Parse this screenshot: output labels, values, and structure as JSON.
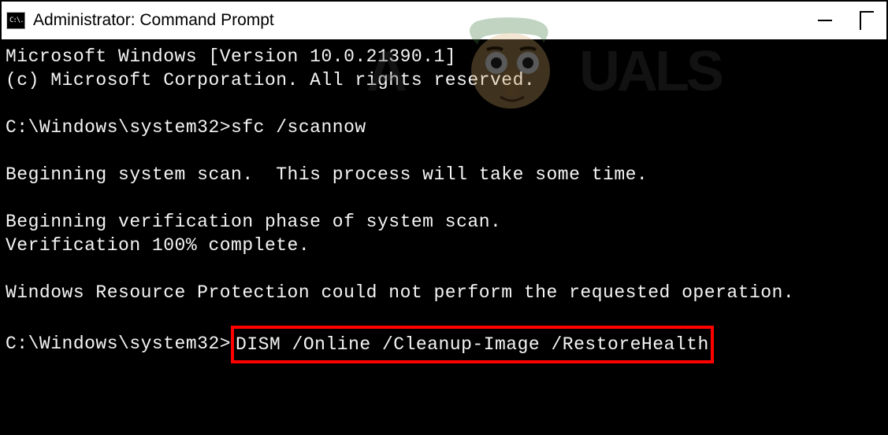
{
  "window": {
    "title": "Administrator: Command Prompt",
    "icon_text": "C:\\."
  },
  "terminal": {
    "line1": "Microsoft Windows [Version 10.0.21390.1]",
    "line2": "(c) Microsoft Corporation. All rights reserved.",
    "prompt1_path": "C:\\Windows\\system32>",
    "prompt1_cmd": "sfc /scannow",
    "line3": "Beginning system scan.  This process will take some time.",
    "line4": "Beginning verification phase of system scan.",
    "line5": "Verification 100% complete.",
    "line6": "Windows Resource Protection could not perform the requested operation.",
    "prompt2_path": "C:\\Windows\\system32>",
    "prompt2_cmd": "DISM /Online /Cleanup-Image /RestoreHealth"
  }
}
